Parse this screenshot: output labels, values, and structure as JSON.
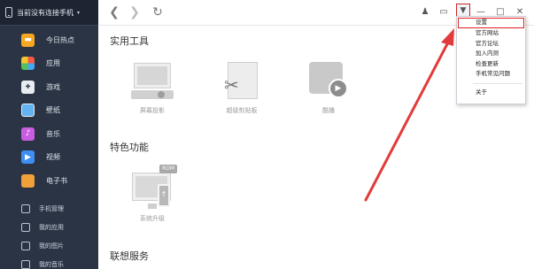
{
  "device": {
    "label": "当前没有连接手机",
    "caret": "▾"
  },
  "sidebar": {
    "items": [
      {
        "label": "今日热点",
        "icon": "hot-news-icon",
        "glyph": "▬"
      },
      {
        "label": "应用",
        "icon": "apps-icon",
        "glyph": ""
      },
      {
        "label": "游戏",
        "icon": "gamepad-icon",
        "glyph": "✚"
      },
      {
        "label": "壁纸",
        "icon": "wallpaper-icon",
        "glyph": ""
      },
      {
        "label": "音乐",
        "icon": "music-icon",
        "glyph": "♪"
      },
      {
        "label": "视频",
        "icon": "video-icon",
        "glyph": "▶"
      },
      {
        "label": "电子书",
        "icon": "ebook-icon",
        "glyph": ""
      }
    ],
    "sub_items": [
      {
        "label": "手机管理",
        "icon": "phone-manage-icon"
      },
      {
        "label": "我的应用",
        "icon": "my-apps-icon"
      },
      {
        "label": "我的图片",
        "icon": "my-pictures-icon"
      },
      {
        "label": "我的音乐",
        "icon": "my-music-icon"
      }
    ]
  },
  "topbar": {
    "back_glyph": "❮",
    "forward_glyph": "❯",
    "refresh_glyph": "↻",
    "notify_glyph": "♟",
    "feedback_glyph": "▭",
    "menu_glyph": "▼",
    "minimize_glyph": "—",
    "maximize_glyph": "□",
    "close_glyph": "✕"
  },
  "sections": {
    "tools_title": "实用工具",
    "featured_title": "特色功能",
    "linked_title": "联想服务"
  },
  "tools": [
    {
      "name": "屏幕投影"
    },
    {
      "name": "超级剪贴板"
    },
    {
      "name": "酷播"
    }
  ],
  "featured": [
    {
      "name": "系统升级",
      "badge": "ROM"
    }
  ],
  "menu": {
    "items": [
      "设置",
      "官方网站",
      "官方论坛",
      "加入内测",
      "检查更新",
      "手机常见问题"
    ],
    "about": "关于"
  },
  "colors": {
    "sidebar_bg": "#2b3444",
    "highlight_red": "#e02020"
  }
}
